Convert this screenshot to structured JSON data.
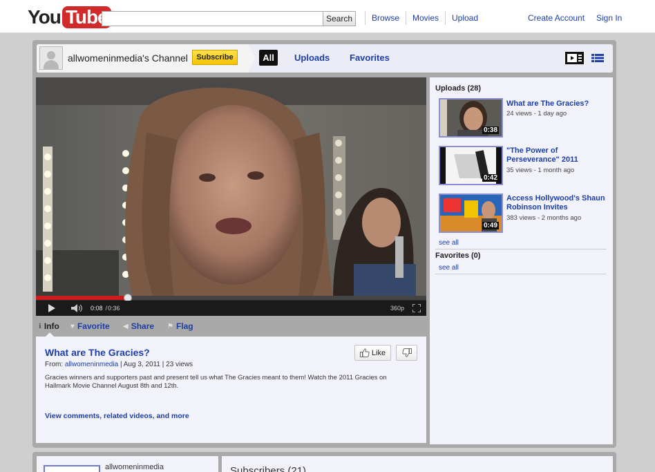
{
  "masthead": {
    "logo_you": "You",
    "logo_tube": "Tube",
    "search_placeholder": "",
    "search_button": "Search",
    "nav": [
      "Browse",
      "Movies",
      "Upload"
    ],
    "create_account": "Create Account",
    "sign_in": "Sign In"
  },
  "channel": {
    "name": "allwomeninmedia's Channel",
    "subscribe": "Subscribe",
    "tabs": {
      "all": "All",
      "uploads": "Uploads",
      "favorites": "Favorites"
    }
  },
  "player": {
    "time_current": "0:08",
    "time_total": "0:36",
    "time_sep": " / ",
    "quality": "360p",
    "progress": 0.235
  },
  "info_tabs": [
    "Info",
    "Favorite",
    "Share",
    "Flag"
  ],
  "video": {
    "title": "What are The Gracies?",
    "from_label": "From:",
    "author": "allwomeninmedia",
    "date": "Aug 3, 2011",
    "views": "23 views",
    "description": "Gracies winners and supporters past and present tell us what The Gracies meant to them! Watch the 2011 Gracies on Hallmark Movie Channel August 8th and 12th.",
    "more_link": "View comments, related videos, and more",
    "like_label": "Like"
  },
  "uploads": {
    "heading": "Uploads (28)",
    "items": [
      {
        "title": "What are The Gracies?",
        "meta": "24 views - 1 day ago",
        "duration": "0:38"
      },
      {
        "title": "\"The Power of Perseverance\" 2011",
        "meta": "35 views - 1 month ago",
        "duration": "0:42"
      },
      {
        "title": "Access Hollywood's Shaun Robinson Invites",
        "meta": "383 views - 2 months ago",
        "duration": "0:49"
      }
    ],
    "see_all": "see all"
  },
  "favorites": {
    "heading": "Favorites (0)",
    "see_all": "see all"
  },
  "bottom": {
    "profile_name": "allwomeninmedia",
    "subscribers_title": "Subscribers (21)"
  },
  "colors": {
    "link": "#1c3ea8",
    "subscribe": "#f4c300",
    "progress_red": "#cc1b1b",
    "panel": "#f2f2fa",
    "frame": "#a9a9a9"
  }
}
